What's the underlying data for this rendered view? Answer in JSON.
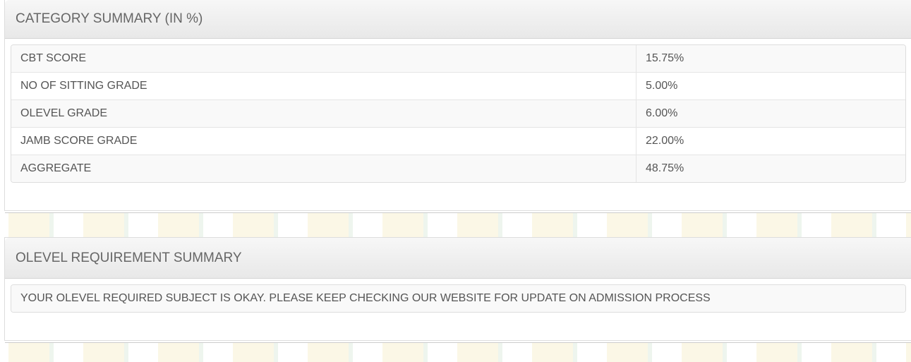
{
  "category": {
    "title": "CATEGORY SUMMARY (IN %)",
    "rows": [
      {
        "label": "CBT SCORE",
        "value": "15.75%"
      },
      {
        "label": "NO OF SITTING GRADE",
        "value": "5.00%"
      },
      {
        "label": "OLEVEL GRADE",
        "value": "6.00%"
      },
      {
        "label": "JAMB SCORE GRADE",
        "value": "22.00%"
      },
      {
        "label": "AGGREGATE",
        "value": "48.75%"
      }
    ]
  },
  "olevel": {
    "title": "OLEVEL REQUIREMENT SUMMARY",
    "message": "YOUR OLEVEL REQUIRED SUBJECT IS OKAY. PLEASE KEEP CHECKING OUR WEBSITE FOR UPDATE ON ADMISSION PROCESS"
  }
}
